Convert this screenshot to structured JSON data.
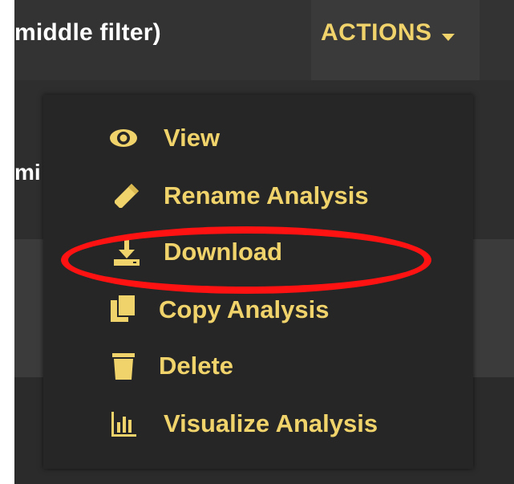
{
  "header": {
    "filter_text": "middle filter)",
    "actions_label": "ACTIONS"
  },
  "row": {
    "partial_text": "mi"
  },
  "menu": {
    "items": [
      {
        "label": "View",
        "icon": "eye-icon"
      },
      {
        "label": "Rename Analysis",
        "icon": "pencil-icon"
      },
      {
        "label": "Download",
        "icon": "download-icon"
      },
      {
        "label": "Copy Analysis",
        "icon": "copy-icon"
      },
      {
        "label": "Delete",
        "icon": "trash-icon"
      },
      {
        "label": "Visualize Analysis",
        "icon": "bar-chart-icon"
      }
    ]
  },
  "colors": {
    "accent": "#f1d36b",
    "highlight": "#ff1212",
    "menu_bg": "#262626"
  }
}
